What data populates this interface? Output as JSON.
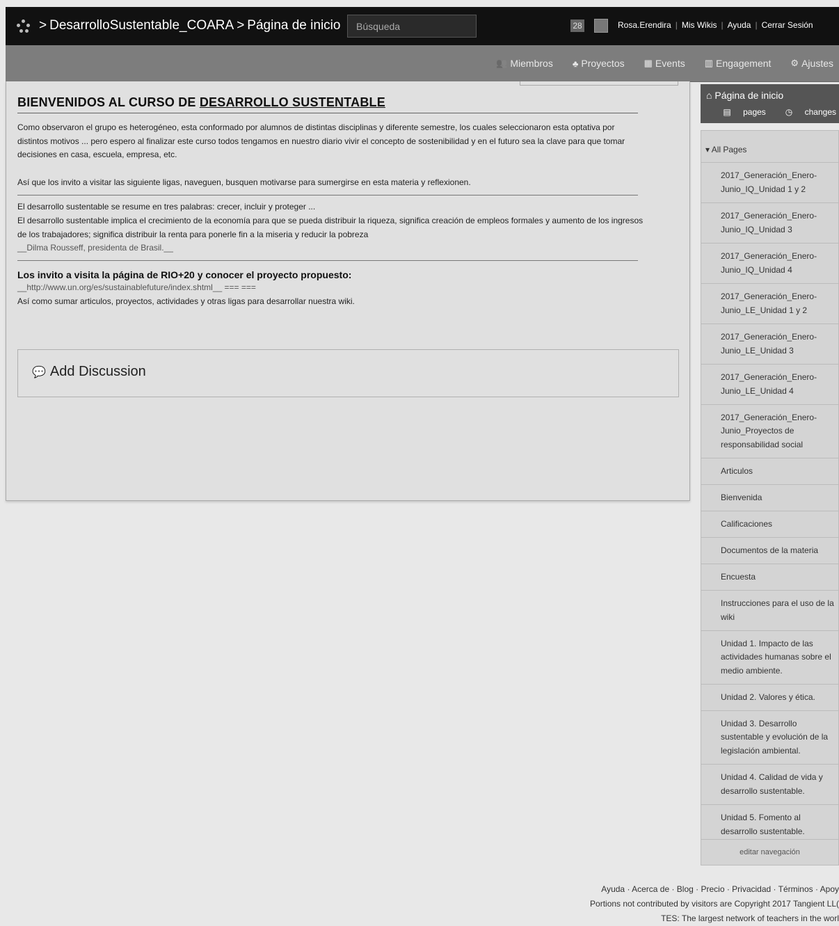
{
  "topbar": {
    "wiki_name": "DesarrolloSustentable_COARA",
    "page_name": "Página de inicio",
    "separator": ">",
    "search_placeholder": "Búsqueda",
    "notification_count": "28",
    "user": "Rosa.Erendira",
    "links": [
      "Mis Wikis",
      "Ayuda",
      "Cerrar Sesión"
    ]
  },
  "subnav": [
    {
      "icon": "members-icon",
      "glyph": "👥",
      "label": "Miembros"
    },
    {
      "icon": "projects-icon",
      "glyph": "♣",
      "label": "Proyectos"
    },
    {
      "icon": "calendar-icon",
      "glyph": "▦",
      "label": "Events"
    },
    {
      "icon": "chart-icon",
      "glyph": "▥",
      "label": "Engagement"
    },
    {
      "icon": "gear-icon",
      "glyph": "⚙",
      "label": "Ajustes"
    }
  ],
  "content": {
    "heading_pre": "BIENVENIDOS AL CURSO DE ",
    "heading_link": "DESARROLLO SUSTENTABLE",
    "para1": "Como observaron el grupo es heterogéneo, esta conformado por alumnos de distintas disciplinas y diferente semestre, los cuales seleccionaron esta optativa por distintos motivos ... pero espero al finalizar este curso todos tengamos en nuestro diario vivir el concepto de sostenibilidad y en el futuro sea la clave para que tomar decisiones en casa, escuela, empresa, etc.",
    "para2": "Así que los invito a visitar las siguiente ligas, naveguen, busquen motivarse para sumergirse en esta materia y reflexionen.",
    "quote1": "El desarrollo sustentable se resume en tres palabras: crecer, incluir y proteger ...",
    "quote2": "El desarrollo sustentable implica el crecimiento de la economía para que se pueda distribuir la riqueza, significa creación de empleos formales y aumento de los ingresos de los trabajadores; significa distribuir la renta para ponerle fin a la miseria y reducir la pobreza",
    "quote_source": "__Dilma Rousseff, presidenta de Brasil.__",
    "subheading": "Los invito a visita la página de RIO+20 y conocer el proyecto propuesto:",
    "link_text": "__http://www.un.org/es/sustainablefuture/index.shtml__",
    "link_suffix": "=== ===",
    "para3": "Así como sumar articulos, proyectos, actividades y otras ligas para desarrollar nuestra wiki.",
    "add_discussion": "Add Discussion"
  },
  "sidebar": {
    "home_label": "Página de inicio",
    "pages_label": "pages",
    "changes_label": "changes",
    "all_pages": "All Pages",
    "items": [
      "2017_Generación_Enero-Junio_IQ_Unidad 1 y 2",
      "2017_Generación_Enero-Junio_IQ_Unidad 3",
      "2017_Generación_Enero-Junio_IQ_Unidad 4",
      "2017_Generación_Enero-Junio_LE_Unidad 1 y 2",
      "2017_Generación_Enero-Junio_LE_Unidad 3",
      "2017_Generación_Enero-Junio_LE_Unidad 4",
      "2017_Generación_Enero-Junio_Proyectos de responsabilidad social",
      "Articulos",
      "Bienvenida",
      "Calificaciones",
      "Documentos de la materia",
      "Encuesta",
      "Instrucciones para el uso de la wiki",
      "Unidad 1. Impacto de las actividades humanas sobre el medio ambiente.",
      "Unidad 2. Valores y ética.",
      "Unidad 3. Desarrollo sustentable y evolución de la legislación ambiental.",
      "Unidad 4. Calidad de vida y desarrollo sustentable.",
      "Unidad 5. Fomento al desarrollo sustentable."
    ],
    "edit_nav": "editar navegación"
  },
  "footer": {
    "links": "Ayuda · Acerca de · Blog · Precio · Privacidad · Términos · Apoy",
    "copyright": "Portions not contributed by visitors are Copyright 2017 Tangient LL(",
    "tes": "TES: The largest network of teachers in the worl"
  }
}
